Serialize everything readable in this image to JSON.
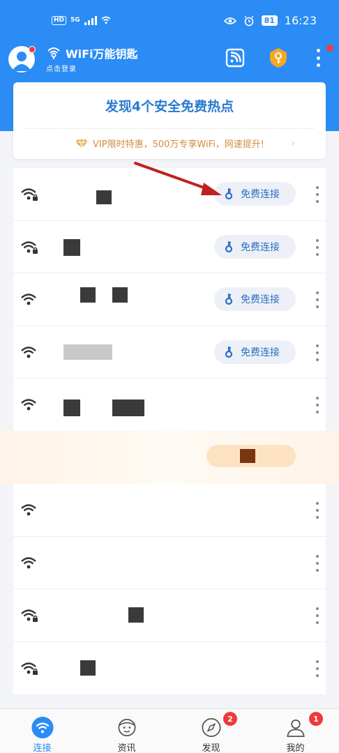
{
  "status_bar": {
    "network": "HD",
    "signal_label": "5G",
    "battery": "81",
    "time": "16:23"
  },
  "header": {
    "app_name": "WiFi万能钥匙",
    "login_text": "点击登录"
  },
  "card": {
    "title": "发现4个安全免费热点",
    "vip_text": "VIP限时特惠，500万专享WiFi，网速提升!",
    "vip_arrow": "›"
  },
  "hotspots": {
    "connect_label": "免费连接"
  },
  "tabs": [
    {
      "label": "连接",
      "icon": "wifi-icon",
      "active": true
    },
    {
      "label": "资讯",
      "icon": "face-icon",
      "active": false
    },
    {
      "label": "发现",
      "icon": "compass-icon",
      "active": false,
      "badge": "2"
    },
    {
      "label": "我的",
      "icon": "user-icon",
      "active": false,
      "badge": "1"
    }
  ],
  "colors": {
    "brand": "#2a8cf4",
    "accent_text": "#2a7ad2",
    "vip": "#d48a40",
    "badge": "#ef3a3a"
  }
}
